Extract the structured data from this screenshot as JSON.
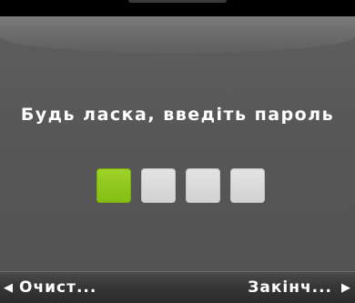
{
  "prompt": {
    "text": "Будь ласка, введіть пароль"
  },
  "pin": {
    "total_digits": 4,
    "entered_digits": 1,
    "filled_color": "#8cc51c",
    "empty_color": "#dcdcdc"
  },
  "softkeys": {
    "left_label": "Очист...",
    "left_icon": "triangle-left-icon",
    "right_label": "Закінч...",
    "right_icon": "triangle-right-icon"
  },
  "colors": {
    "panel_background": "#575757",
    "softkey_bar_background": "#353535"
  }
}
